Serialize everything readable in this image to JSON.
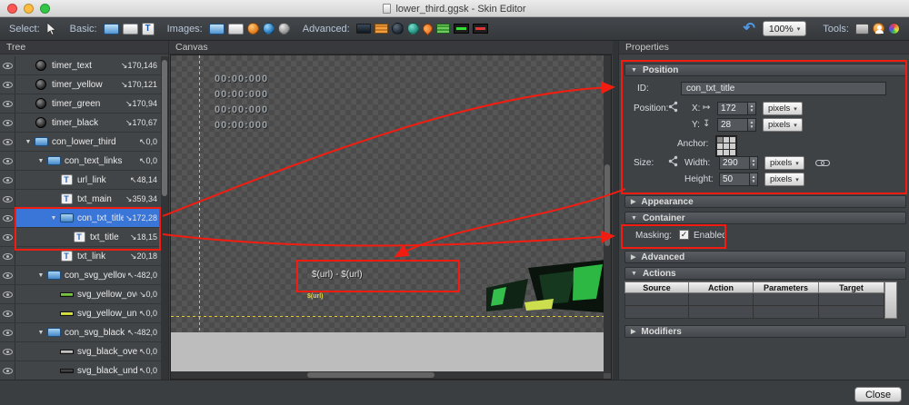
{
  "window": {
    "title": "lower_third.ggsk - Skin Editor",
    "traffic_lights": {
      "close": "#fc5753",
      "minimize": "#fdbc40",
      "maximize": "#33c748"
    }
  },
  "toolbar": {
    "select_label": "Select:",
    "basic_label": "Basic:",
    "images_label": "Images:",
    "advanced_label": "Advanced:",
    "tools_label": "Tools:",
    "zoom_value": "100%"
  },
  "panels": {
    "tree_title": "Tree",
    "canvas_title": "Canvas",
    "properties_title": "Properties"
  },
  "tree": {
    "items": [
      {
        "label": "timer_text",
        "coords": "↘170,146",
        "icon": "timer-icon"
      },
      {
        "label": "timer_yellow",
        "coords": "↘170,121",
        "icon": "timer-icon"
      },
      {
        "label": "timer_green",
        "coords": "↘170,94",
        "icon": "timer-icon"
      },
      {
        "label": "timer_black",
        "coords": "↘170,67",
        "icon": "timer-icon"
      },
      {
        "label": "con_lower_third",
        "coords": "↖0,0",
        "icon": "container-icon"
      },
      {
        "label": "con_text_links",
        "coords": "↖0,0",
        "icon": "container-icon"
      },
      {
        "label": "url_link",
        "coords": "↖48,14",
        "icon": "text-icon"
      },
      {
        "label": "txt_main",
        "coords": "↘359,34",
        "icon": "text-icon"
      },
      {
        "label": "con_txt_title",
        "coords": "↘172,28",
        "icon": "container-icon",
        "selected": true
      },
      {
        "label": "txt_title",
        "coords": "↘18,15",
        "icon": "text-icon"
      },
      {
        "label": "txt_link",
        "coords": "↘20,18",
        "icon": "text-icon"
      },
      {
        "label": "con_svg_yellow",
        "coords": "↖-482,0",
        "icon": "container-icon"
      },
      {
        "label": "svg_yellow_over",
        "coords": "↘0,0",
        "icon": "line-green-icon"
      },
      {
        "label": "svg_yellow_under",
        "coords": "↖0,0",
        "icon": "line-yellow-icon"
      },
      {
        "label": "con_svg_black",
        "coords": "↖-482,0",
        "icon": "container-icon"
      },
      {
        "label": "svg_black_over",
        "coords": "↖0,0",
        "icon": "line-gray-icon"
      },
      {
        "label": "svg_black_under",
        "coords": "↖0,0",
        "icon": "line-dark-icon"
      }
    ]
  },
  "canvas": {
    "timer_lines": [
      "00:00:000",
      "00:00:000",
      "00:00:000",
      "00:00:000"
    ],
    "url_text": "$(url) - $(url)",
    "url_small_label": "$(url)"
  },
  "properties": {
    "position_section": {
      "header": "Position",
      "id_label": "ID:",
      "id_value": "con_txt_title",
      "position_label": "Position:",
      "x_label": "X:",
      "x_value": "172",
      "x_unit": "pixels",
      "y_label": "Y:",
      "y_value": "28",
      "y_unit": "pixels",
      "anchor_label": "Anchor:",
      "size_label": "Size:",
      "width_label": "Width:",
      "width_value": "290",
      "width_unit": "pixels",
      "height_label": "Height:",
      "height_value": "50",
      "height_unit": "pixels"
    },
    "appearance_header": "Appearance",
    "container_section": {
      "header": "Container",
      "masking_label": "Masking:",
      "masking_value": "Enabled",
      "masking_checked": true
    },
    "advanced_header": "Advanced",
    "actions_section": {
      "header": "Actions",
      "columns": [
        "Source",
        "Action",
        "Parameters",
        "Target"
      ]
    },
    "modifiers_header": "Modifiers"
  },
  "bottom": {
    "close_label": "Close"
  },
  "colors": {
    "selection": "#3a76d8",
    "annotation": "#f21d10"
  },
  "icons": {
    "expanded": "▼",
    "collapsed": "▶",
    "caret": "▾",
    "step_up": "▲",
    "step_down": "▼",
    "text_glyph": "T",
    "undo": "↶",
    "x_axis": "↦",
    "y_axis": "↧",
    "check": "✓"
  }
}
